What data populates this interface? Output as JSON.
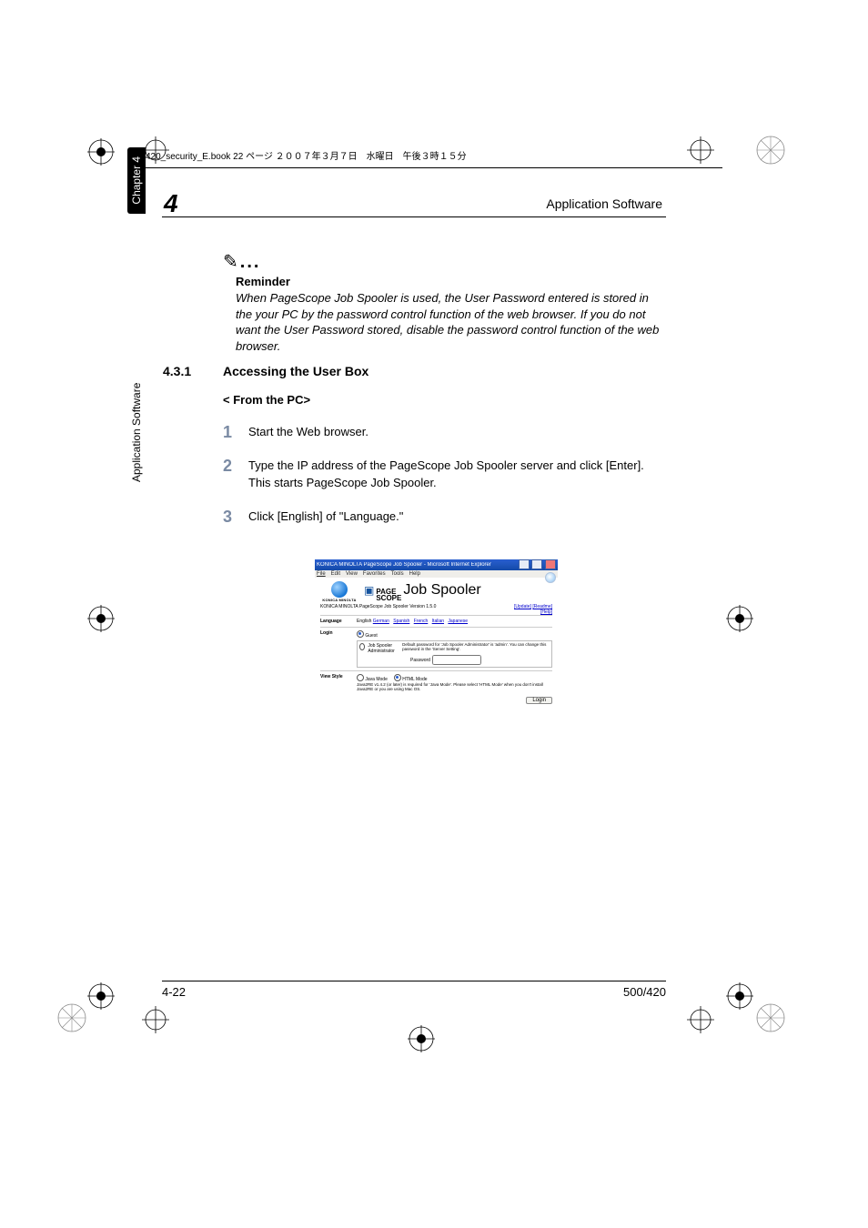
{
  "print_header": "420_security_E.book  22 ページ  ２００７年３月７日　水曜日　午後３時１５分",
  "chapter_num": "4",
  "chapter_title": "Application Software",
  "reminder": {
    "heading": "Reminder",
    "body": "When PageScope Job Spooler is used, the User Password entered is stored in the your PC by the password control function of the web browser. If you do not want the User Password stored, disable the password control function of the web browser."
  },
  "section": {
    "num": "4.3.1",
    "title": "Accessing the User Box",
    "sub": "< From the PC>"
  },
  "steps": [
    {
      "n": "1",
      "t": "Start the Web browser."
    },
    {
      "n": "2",
      "t": "Type the IP address of the PageScope Job Spooler server and click [Enter].\nThis starts PageScope Job Spooler."
    },
    {
      "n": "3",
      "t": "Click [English] of \"Language.\""
    }
  ],
  "screenshot": {
    "window_title": "KONICA MINOLTA PageScope Job Spooler - Microsoft Internet Explorer",
    "menus": [
      "File",
      "Edit",
      "View",
      "Favorites",
      "Tools",
      "Help"
    ],
    "brand": "KONICA MINOLTA",
    "logo1": "PAGE SCOPE",
    "logo2": "Job Spooler",
    "subline": "KONICA MINOLTA PageScope Job Spooler Version 1.5.0",
    "links": {
      "update": "[Update]",
      "readme": "[Readme]",
      "help": "[Help]"
    },
    "language_label": "Language",
    "languages": [
      "English",
      "German",
      "Spanish",
      "French",
      "Italian",
      "Japanese"
    ],
    "login_label": "Login",
    "guest": "Guest",
    "admin": "Job Spooler Administrator",
    "admin_info": "Default password for 'Job Spooler Administrator' is 'admin'. You can change this password in the 'Server Setting'.",
    "password_label": "Password",
    "viewstyle_label": "View Style",
    "java_mode": "Java Mode",
    "html_mode": "HTML Mode",
    "viewstyle_note": "Java2RE v1.4.2 (or later) is required for 'Java Mode'. Please select 'HTML Mode' when you don't install Java2RE or you are using Mac OS.",
    "login_button": "Login"
  },
  "sidebar": {
    "plain": "Application Software",
    "chip": "Chapter 4"
  },
  "footer": {
    "left": "4-22",
    "right": "500/420"
  }
}
